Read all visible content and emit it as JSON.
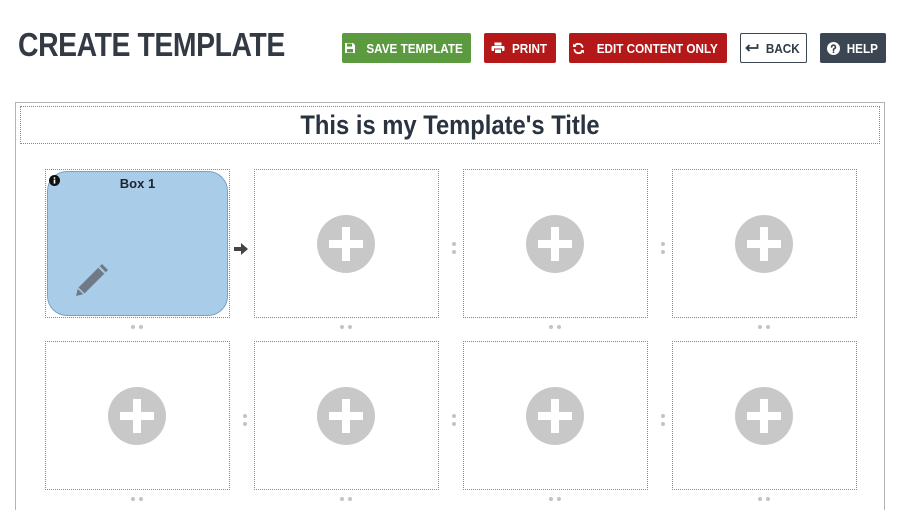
{
  "page": {
    "title": "CREATE TEMPLATE"
  },
  "toolbar": {
    "save_label": "SAVE TEMPLATE",
    "print_label": "PRINT",
    "edit_label": "EDIT CONTENT ONLY",
    "back_label": "BACK",
    "help_label": "HELP"
  },
  "icons": {
    "save": "floppy-disk-icon",
    "print": "printer-icon",
    "edit": "sync-icon",
    "back": "back-arrow-icon",
    "help": "question-circle-icon",
    "add": "plus-circle-icon",
    "info": "info-icon",
    "edit_box": "pencil-icon",
    "connector": "arrow-right-icon"
  },
  "template": {
    "title": "This is my Template's Title",
    "boxes": [
      {
        "label": "Box 1",
        "filled": true
      },
      {
        "label": "",
        "filled": false
      },
      {
        "label": "",
        "filled": false
      },
      {
        "label": "",
        "filled": false
      },
      {
        "label": "",
        "filled": false
      },
      {
        "label": "",
        "filled": false
      },
      {
        "label": "",
        "filled": false
      },
      {
        "label": "",
        "filled": false
      }
    ]
  },
  "colors": {
    "save": "#5b9a3e",
    "danger": "#b51818",
    "dark": "#3b4652",
    "box_fill": "#a9cde9",
    "placeholder": "#c8c8c8"
  }
}
